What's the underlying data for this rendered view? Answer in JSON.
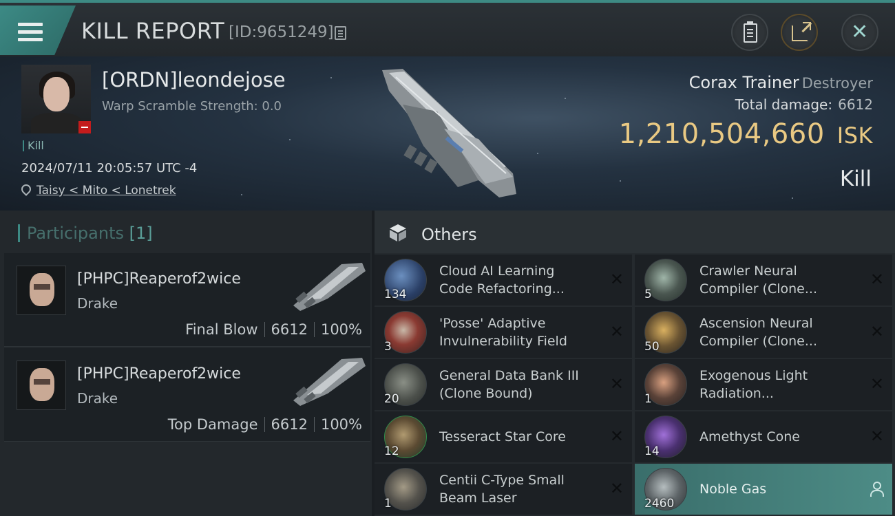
{
  "header": {
    "title": "KILL REPORT",
    "report_id": "[ID:9651249]"
  },
  "victim": {
    "name": "[ORDN]leondejose",
    "warp_scramble": "Warp Scramble Strength: 0.0",
    "tag": "Kill",
    "timestamp": "2024/07/11 20:05:57 UTC -4",
    "location": "Taisy < Mito < Lonetrek"
  },
  "ship": {
    "name": "Corax Trainer",
    "class": "Destroyer",
    "total_damage_label": "Total damage:",
    "total_damage": "6612",
    "isk_value": "1,210,504,660",
    "isk_unit": "ISK",
    "result": "Kill"
  },
  "participants": {
    "title": "Participants",
    "count": "[1]",
    "cards": [
      {
        "name": "[PHPC]Reaperof2wice",
        "ship": "Drake",
        "label": "Final Blow",
        "damage": "6612",
        "percent": "100%"
      },
      {
        "name": "[PHPC]Reaperof2wice",
        "ship": "Drake",
        "label": "Top Damage",
        "damage": "6612",
        "percent": "100%"
      }
    ]
  },
  "others": {
    "title": "Others",
    "items": [
      {
        "qty": "134",
        "name1": "Cloud AI Learning",
        "name2": "Code Refactoring...",
        "icon": "cloud-ai-icon"
      },
      {
        "qty": "5",
        "name1": "Crawler Neural",
        "name2": "Compiler (Clone...",
        "icon": "neural-compiler-icon"
      },
      {
        "qty": "3",
        "name1": "'Posse' Adaptive",
        "name2": "Invulnerability Field",
        "icon": "shield-module-icon"
      },
      {
        "qty": "50",
        "name1": "Ascension Neural",
        "name2": "Compiler (Clone...",
        "icon": "neural-compiler-icon"
      },
      {
        "qty": "20",
        "name1": "General Data Bank III",
        "name2": "(Clone Bound)",
        "icon": "data-bank-icon"
      },
      {
        "qty": "1",
        "name1": "Exogenous Light",
        "name2": "Radiation...",
        "icon": "radiation-icon"
      },
      {
        "qty": "12",
        "name1": "Tesseract Star Core",
        "name2": "",
        "icon": "star-core-icon"
      },
      {
        "qty": "14",
        "name1": "Amethyst Cone",
        "name2": "",
        "icon": "amethyst-icon"
      },
      {
        "qty": "1",
        "name1": "Centii C-Type Small",
        "name2": "Beam Laser",
        "icon": "beam-laser-icon"
      },
      {
        "qty": "2460",
        "name1": "Noble Gas",
        "name2": "",
        "icon": "gas-canister-icon"
      }
    ]
  },
  "colors": {
    "accent": "#3d8a84",
    "isk": "#e9c983",
    "selected_item": "#4d8c86"
  }
}
